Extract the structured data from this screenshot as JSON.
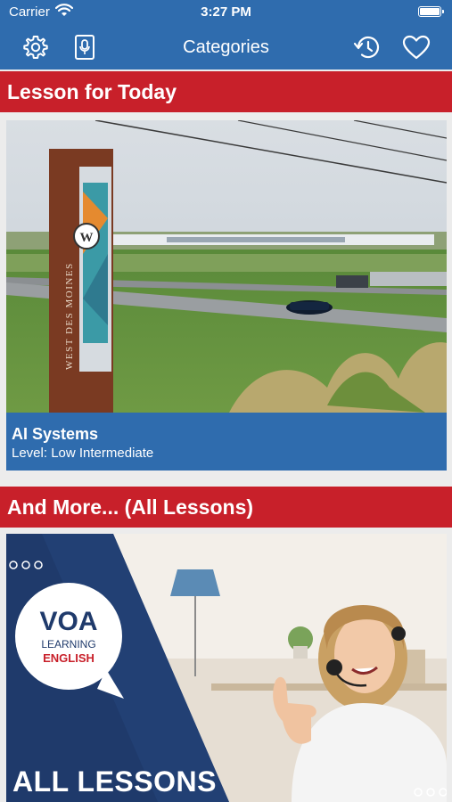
{
  "status": {
    "carrier": "Carrier",
    "time": "3:27 PM"
  },
  "nav": {
    "title": "Categories"
  },
  "sections": {
    "today": "Lesson for Today",
    "more": "And More... (All Lessons)"
  },
  "lesson": {
    "title": "AI Systems",
    "level": "Level: Low Intermediate",
    "sign_text": "WEST DES MOINES"
  },
  "all_lessons": {
    "title": "ALL LESSONS",
    "logo_line1": "VOA",
    "logo_line2": "LEARNING",
    "logo_line3": "ENGLISH"
  },
  "colors": {
    "brand_blue": "#2f6cae",
    "header_red": "#c8202a",
    "voa_navy": "#1f3a6b"
  },
  "icons": [
    "wifi-icon",
    "battery-icon",
    "gear-icon",
    "microphone-icon",
    "history-icon",
    "heart-icon"
  ]
}
